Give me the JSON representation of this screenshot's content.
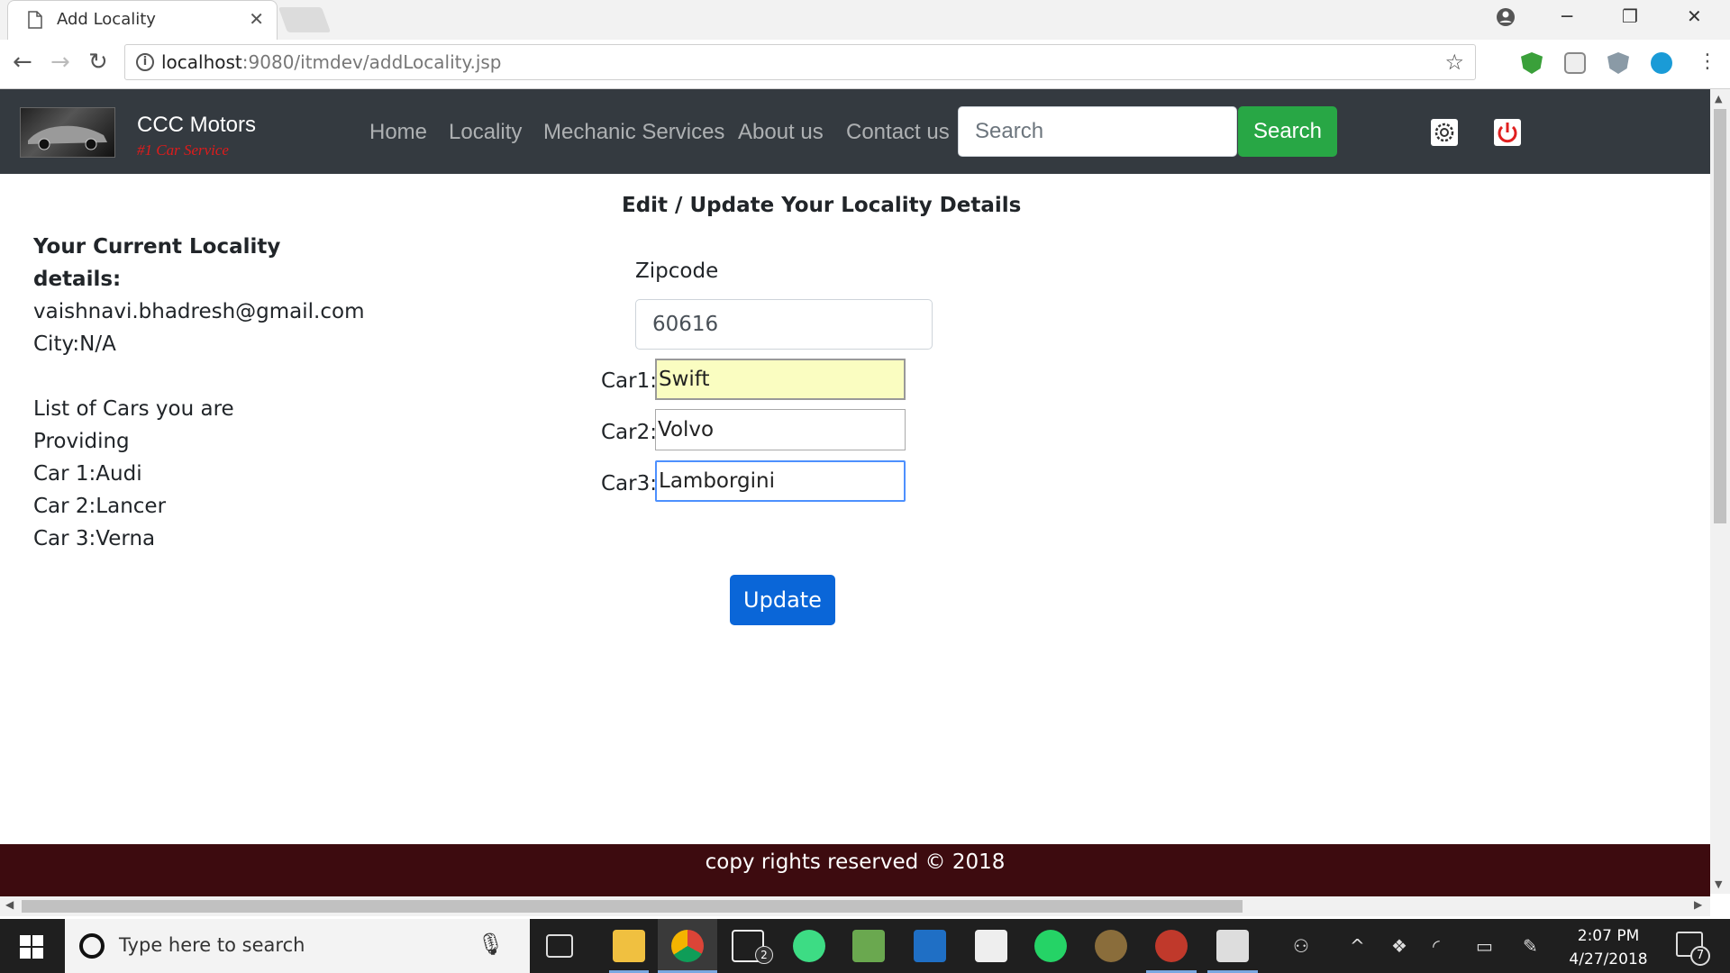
{
  "browser": {
    "tab_title": "Add Locality",
    "close_glyph": "✕",
    "url_host": "localhost",
    "url_rest": ":9080/itmdev/addLocality.jsp",
    "window_controls": {
      "minimize": "─",
      "restore": "❐",
      "close": "✕"
    }
  },
  "navbar": {
    "brand": "CCC Motors",
    "tagline": "#1 Car Service",
    "links": [
      "Home",
      "Locality",
      "Mechanic Services",
      "About us",
      "Contact us"
    ],
    "search_placeholder": "Search",
    "search_button": "Search"
  },
  "page": {
    "form_title": "Edit / Update Your Locality Details",
    "current": {
      "heading_line1": "Your Current Locality",
      "heading_line2": "details:",
      "email": "vaishnavi.bhadresh@gmail.com",
      "city": "City:N/A",
      "cars_heading_line1": "List of Cars you are",
      "cars_heading_line2": "Providing",
      "cars": [
        "Car 1:Audi",
        "Car 2:Lancer",
        "Car 3:Verna"
      ]
    },
    "form": {
      "zipcode_label": "Zipcode",
      "zipcode_value": "60616",
      "car1_label": "Car1:",
      "car1_value": "Swift",
      "car2_label": "Car2:",
      "car2_value": "Volvo",
      "car3_label": "Car3:",
      "car3_value": "Lamborgini",
      "update_button": "Update"
    },
    "footer": "copy rights reserved © 2018"
  },
  "taskbar": {
    "search_placeholder": "Type here to search",
    "time": "2:07 PM",
    "date": "4/27/2018",
    "mail_badge": "2",
    "notification_count": "7"
  },
  "colors": {
    "navbar_bg": "#343a40",
    "search_button_bg": "#28a745",
    "update_button_bg": "#0a66d8",
    "footer_bg": "#3d0b0f",
    "tagline": "#e01b1b",
    "power_icon": "#e02020"
  }
}
